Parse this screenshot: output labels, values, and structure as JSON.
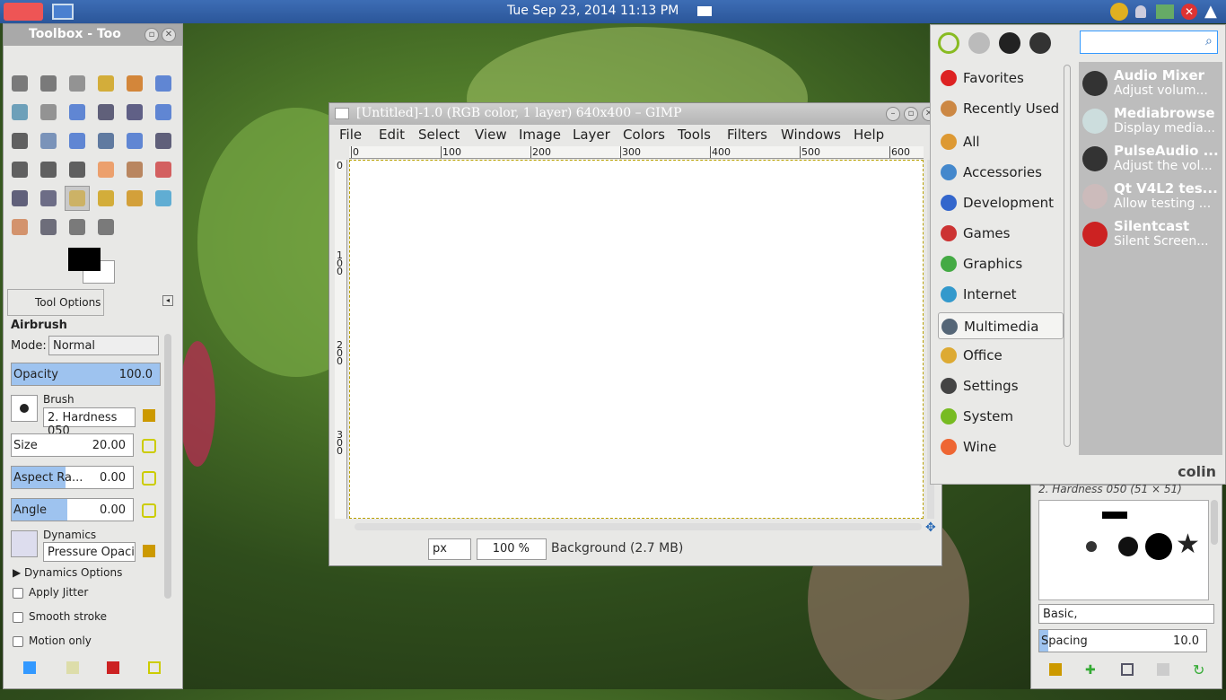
{
  "taskbar": {
    "datetime": "Tue Sep 23, 2014   11:13 PM"
  },
  "toolbox": {
    "title": "Toolbox - Too",
    "tool_options_tab": "Tool Options",
    "tool_name": "Airbrush",
    "mode_label": "Mode:",
    "mode_value": "Normal",
    "opacity_label": "Opacity",
    "opacity_value": "100.0",
    "opacity_fraction": 1.0,
    "brush_label": "Brush",
    "brush_value": "2. Hardness 050",
    "size_label": "Size",
    "size_value": "20.00",
    "aspect_label": "Aspect Ra...",
    "aspect_value": "0.00",
    "angle_label": "Angle",
    "angle_value": "0.00",
    "dynamics_label": "Dynamics",
    "dynamics_value": "Pressure Opacity",
    "dynamics_options": "Dynamics Options",
    "apply_jitter": "Apply Jitter",
    "smooth_stroke": "Smooth stroke",
    "motion_only": "Motion only"
  },
  "gimp": {
    "title": "[Untitled]-1.0 (RGB color, 1 layer) 640x400 – GIMP",
    "menus": [
      "File",
      "Edit",
      "Select",
      "View",
      "Image",
      "Layer",
      "Colors",
      "Tools",
      "Filters",
      "Windows",
      "Help"
    ],
    "ruler_h": [
      "0",
      "100",
      "200",
      "300",
      "400",
      "500",
      "600"
    ],
    "ruler_v": [
      "0",
      "100",
      "200",
      "300"
    ],
    "unit": "px",
    "zoom": "100 %",
    "status": "Background (2.7 MB)"
  },
  "app_menu": {
    "search_placeholder": "",
    "categories": [
      "Favorites",
      "Recently Used",
      "All",
      "Accessories",
      "Development",
      "Games",
      "Graphics",
      "Internet",
      "Multimedia",
      "Office",
      "Settings",
      "System",
      "Wine"
    ],
    "selected": "Multimedia",
    "apps": [
      {
        "name": "Audio Mixer",
        "desc": "Adjust volum..."
      },
      {
        "name": "Mediabrowse",
        "desc": "Display media..."
      },
      {
        "name": "PulseAudio ...",
        "desc": "Adjust the vol..."
      },
      {
        "name": "Qt V4L2 tes...",
        "desc": "Allow testing ..."
      },
      {
        "name": "Silentcast",
        "desc": "Silent Screen..."
      }
    ],
    "user": "colin"
  },
  "brushes": {
    "title": "2. Hardness 050 (51 × 51)",
    "tag": "Basic,",
    "spacing_label": "Spacing",
    "spacing_value": "10.0"
  }
}
